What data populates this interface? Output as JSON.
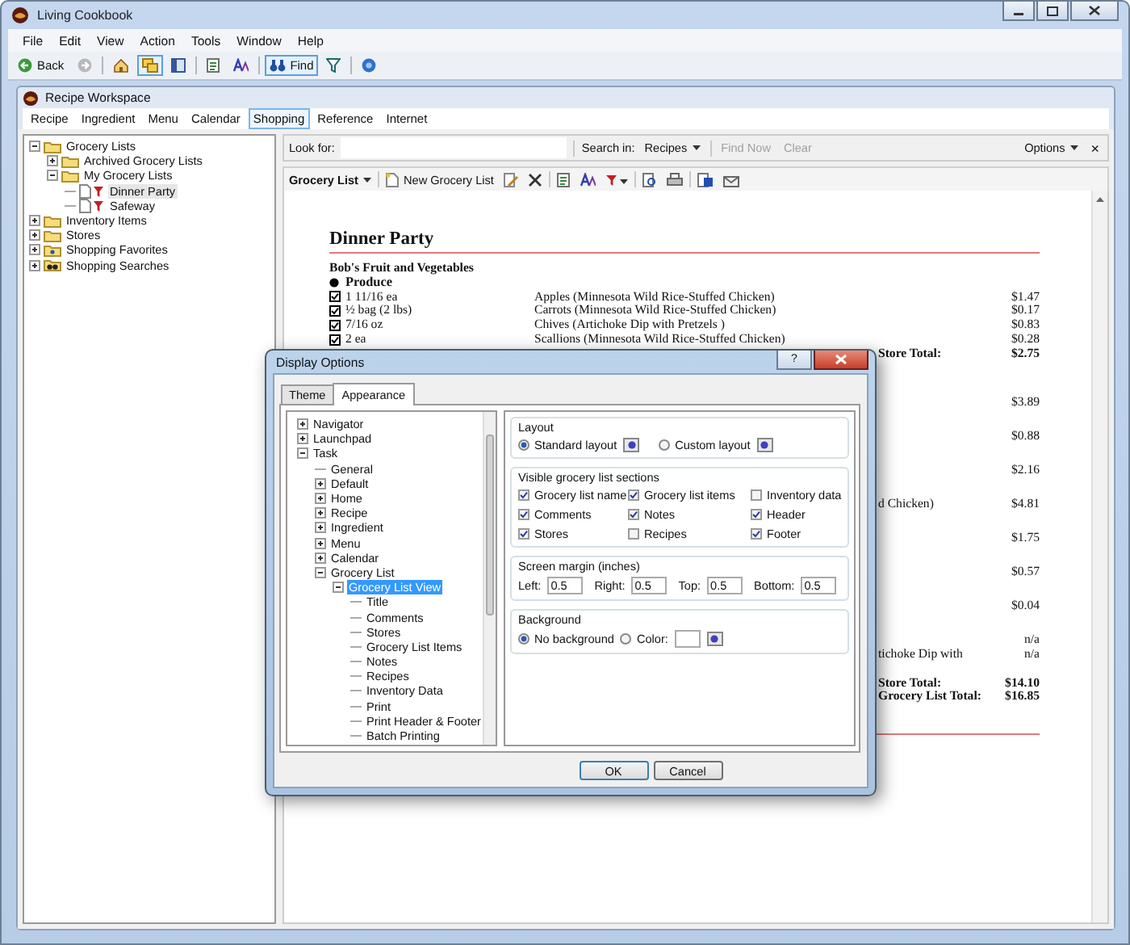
{
  "window": {
    "title": "Living Cookbook"
  },
  "menu": [
    "File",
    "Edit",
    "View",
    "Action",
    "Tools",
    "Window",
    "Help"
  ],
  "toolbar": [
    {
      "kind": "back",
      "label": "Back",
      "pressed": false
    },
    {
      "kind": "forward",
      "pressed": false
    },
    {
      "kind": "separator"
    },
    {
      "kind": "home",
      "pressed": false
    },
    {
      "kind": "folders",
      "pressed": true
    },
    {
      "kind": "panes",
      "pressed": false
    },
    {
      "kind": "separator"
    },
    {
      "kind": "notes",
      "pressed": false
    },
    {
      "kind": "font",
      "pressed": false
    },
    {
      "kind": "separator"
    },
    {
      "kind": "find",
      "label": "Find",
      "pressed": true
    },
    {
      "kind": "filter",
      "pressed": false
    },
    {
      "kind": "separator"
    },
    {
      "kind": "help",
      "pressed": false
    }
  ],
  "workspace": {
    "title": "Recipe Workspace",
    "tabs": [
      {
        "label": "Recipe",
        "selected": false
      },
      {
        "label": "Ingredient",
        "selected": false
      },
      {
        "label": "Menu",
        "selected": false
      },
      {
        "label": "Calendar",
        "selected": false
      },
      {
        "label": "Shopping",
        "selected": true
      },
      {
        "label": "Reference",
        "selected": false
      },
      {
        "label": "Internet",
        "selected": false
      }
    ]
  },
  "navigator": {
    "tree": [
      {
        "label": "Grocery Lists",
        "kind": "folder",
        "expanded": true,
        "selected": false,
        "children": [
          {
            "label": "Archived Grocery Lists",
            "kind": "folder",
            "expanded": false,
            "selected": false
          },
          {
            "label": "My Grocery Lists",
            "kind": "folder",
            "expanded": true,
            "selected": false,
            "children": [
              {
                "label": "Dinner Party",
                "kind": "list",
                "selected": true
              },
              {
                "label": "Safeway",
                "kind": "list",
                "selected": false
              }
            ]
          }
        ]
      },
      {
        "label": "Inventory Items",
        "kind": "folder",
        "expanded": false,
        "selected": false
      },
      {
        "label": "Stores",
        "kind": "folder",
        "expanded": false,
        "selected": false
      },
      {
        "label": "Shopping Favorites",
        "kind": "favorites",
        "expanded": false,
        "selected": false
      },
      {
        "label": "Shopping Searches",
        "kind": "search",
        "expanded": false,
        "selected": false
      }
    ]
  },
  "search_bar": {
    "label": "Look for:",
    "search_in_label": "Search in:",
    "search_in": "Recipes",
    "find_now": {
      "label": "Find Now",
      "disabled": true
    },
    "clear": {
      "label": "Clear",
      "disabled": true
    },
    "options": "Options",
    "close": "×"
  },
  "list_toolbar": {
    "menu": "Grocery List",
    "new_button": "New Grocery List"
  },
  "document": {
    "title": "Dinner Party",
    "lines": [
      {
        "kind": "store",
        "text": "Bob's Fruit and Vegetables"
      },
      {
        "kind": "category",
        "text": "Produce"
      },
      {
        "kind": "item",
        "checked": true,
        "quantity": "1 11/16 ea",
        "name": "Apples (Minnesota Wild Rice-Stuffed Chicken)",
        "price": "$1.47"
      },
      {
        "kind": "item",
        "checked": true,
        "quantity": "½ bag (2 lbs)",
        "name": "Carrots (Minnesota Wild Rice-Stuffed Chicken)",
        "price": "$0.17"
      },
      {
        "kind": "item",
        "checked": true,
        "quantity": "7/16 oz",
        "name": "Chives (Artichoke Dip with Pretzels )",
        "price": "$0.83"
      },
      {
        "kind": "item",
        "checked": true,
        "quantity": "2 ea",
        "name": "Scallions (Minnesota Wild Rice-Stuffed Chicken)",
        "price": "$0.28"
      },
      {
        "kind": "total",
        "text": "Store Total:",
        "price": "$2.75"
      },
      {
        "kind": "partial",
        "price": "$3.89"
      },
      {
        "kind": "partial",
        "price": "$0.88"
      },
      {
        "kind": "partial",
        "price": "$2.16"
      },
      {
        "kind": "partial",
        "text": "d Chicken)",
        "price": "$4.81"
      },
      {
        "kind": "partial",
        "price": "$1.75"
      },
      {
        "kind": "partial",
        "price": "$0.57"
      },
      {
        "kind": "partial",
        "price": "$0.04"
      },
      {
        "kind": "partial",
        "price": "n/a"
      },
      {
        "kind": "partial",
        "text": "tichoke Dip with",
        "price": "n/a"
      },
      {
        "kind": "total",
        "text": "Store Total:",
        "price": "$14.10"
      },
      {
        "kind": "total",
        "text": "Grocery List Total:",
        "price": "$16.85"
      }
    ]
  },
  "dialog": {
    "title": "Display Options",
    "help": "?",
    "tabs": [
      {
        "label": "Theme",
        "selected": false
      },
      {
        "label": "Appearance",
        "selected": true
      }
    ],
    "tree": [
      {
        "label": "Navigator",
        "expanded": false,
        "selected": false
      },
      {
        "label": "Launchpad",
        "expanded": false,
        "selected": false
      },
      {
        "label": "Task",
        "expanded": true,
        "selected": false,
        "children": [
          {
            "label": "General",
            "selected": false
          },
          {
            "label": "Default",
            "expanded": false,
            "selected": false
          },
          {
            "label": "Home",
            "expanded": false,
            "selected": false
          },
          {
            "label": "Recipe",
            "expanded": false,
            "selected": false
          },
          {
            "label": "Ingredient",
            "expanded": false,
            "selected": false
          },
          {
            "label": "Menu",
            "expanded": false,
            "selected": false
          },
          {
            "label": "Calendar",
            "expanded": false,
            "selected": false
          },
          {
            "label": "Grocery List",
            "expanded": true,
            "selected": false,
            "children": [
              {
                "label": "Grocery List View",
                "expanded": true,
                "selected": true,
                "children": [
                  {
                    "label": "Title",
                    "selected": false
                  },
                  {
                    "label": "Comments",
                    "selected": false
                  },
                  {
                    "label": "Stores",
                    "selected": false
                  },
                  {
                    "label": "Grocery List Items",
                    "selected": false
                  },
                  {
                    "label": "Notes",
                    "selected": false
                  },
                  {
                    "label": "Recipes",
                    "selected": false
                  },
                  {
                    "label": "Inventory Data",
                    "selected": false
                  },
                  {
                    "label": "Print",
                    "selected": false
                  },
                  {
                    "label": "Print Header & Footer",
                    "selected": false
                  },
                  {
                    "label": "Batch Printing",
                    "selected": false
                  }
                ]
              }
            ]
          }
        ]
      }
    ],
    "layout": {
      "title": "Layout",
      "options": [
        {
          "label": "Standard layout",
          "selected": true
        },
        {
          "label": "Custom layout",
          "selected": false
        }
      ]
    },
    "sections": {
      "title": "Visible grocery list sections",
      "items": [
        {
          "label": "Grocery list name",
          "checked": true
        },
        {
          "label": "Grocery list items",
          "checked": true
        },
        {
          "label": "Inventory data",
          "checked": false
        },
        {
          "label": "Comments",
          "checked": true
        },
        {
          "label": "Notes",
          "checked": true
        },
        {
          "label": "Header",
          "checked": true
        },
        {
          "label": "Stores",
          "checked": true
        },
        {
          "label": "Recipes",
          "checked": false
        },
        {
          "label": "Footer",
          "checked": true
        }
      ]
    },
    "margins": {
      "title": "Screen margin (inches)",
      "fields": [
        {
          "label": "Left:",
          "value": "0.5"
        },
        {
          "label": "Right:",
          "value": "0.5"
        },
        {
          "label": "Top:",
          "value": "0.5"
        },
        {
          "label": "Bottom:",
          "value": "0.5"
        }
      ]
    },
    "background": {
      "title": "Background",
      "options": [
        {
          "label": "No background",
          "selected": true
        },
        {
          "label": "Color:",
          "selected": false
        }
      ]
    },
    "buttons": [
      "OK",
      "Cancel"
    ]
  }
}
